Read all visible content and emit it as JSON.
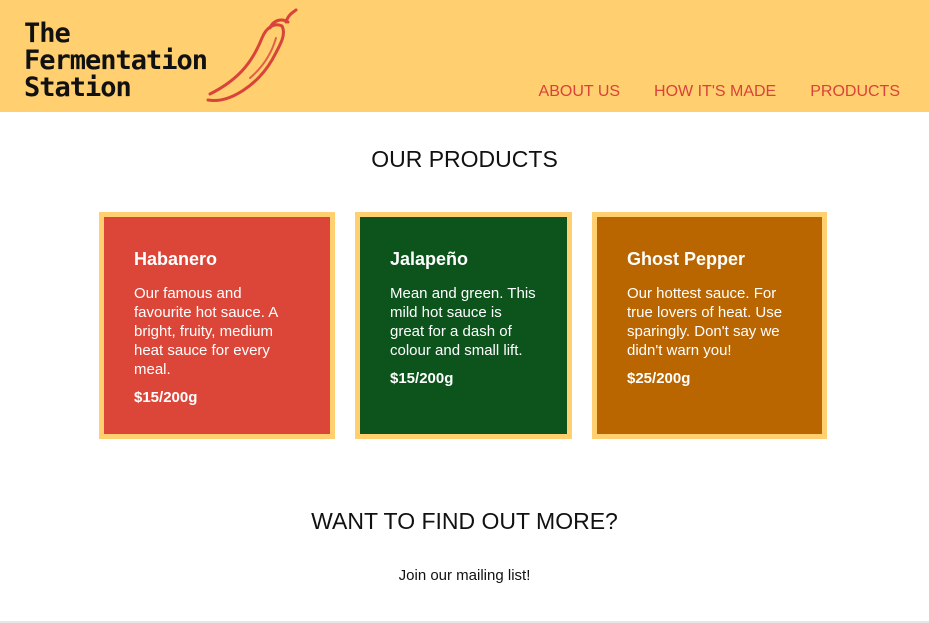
{
  "header": {
    "logo_lines": [
      "The",
      "Fermentation",
      "Station"
    ],
    "nav": [
      "ABOUT US",
      "HOW IT'S MADE",
      "PRODUCTS"
    ],
    "accent_color": "#d8433a",
    "background_color": "#ffcf70"
  },
  "products_section": {
    "title": "OUR PRODUCTS",
    "cards": [
      {
        "name": "Habanero",
        "description": "Our famous and favourite hot sauce. A bright, fruity, medium heat sauce for every meal.",
        "price": "$15/200g",
        "color": "#dc4638"
      },
      {
        "name": "Jalapeño",
        "description": "Mean and green. This mild hot sauce is great for a dash of colour and small lift.",
        "price": "$15/200g",
        "color": "#0c541c"
      },
      {
        "name": "Ghost Pepper",
        "description": "Our hottest sauce. For true lovers of heat. Use sparingly. Don't say we didn't warn you!",
        "price": "$25/200g",
        "color": "#b96500"
      }
    ]
  },
  "more_section": {
    "title": "WANT TO FIND OUT MORE?",
    "text": "Join our mailing list!"
  },
  "icons": {
    "logo_icon": "chili-pepper-icon"
  }
}
